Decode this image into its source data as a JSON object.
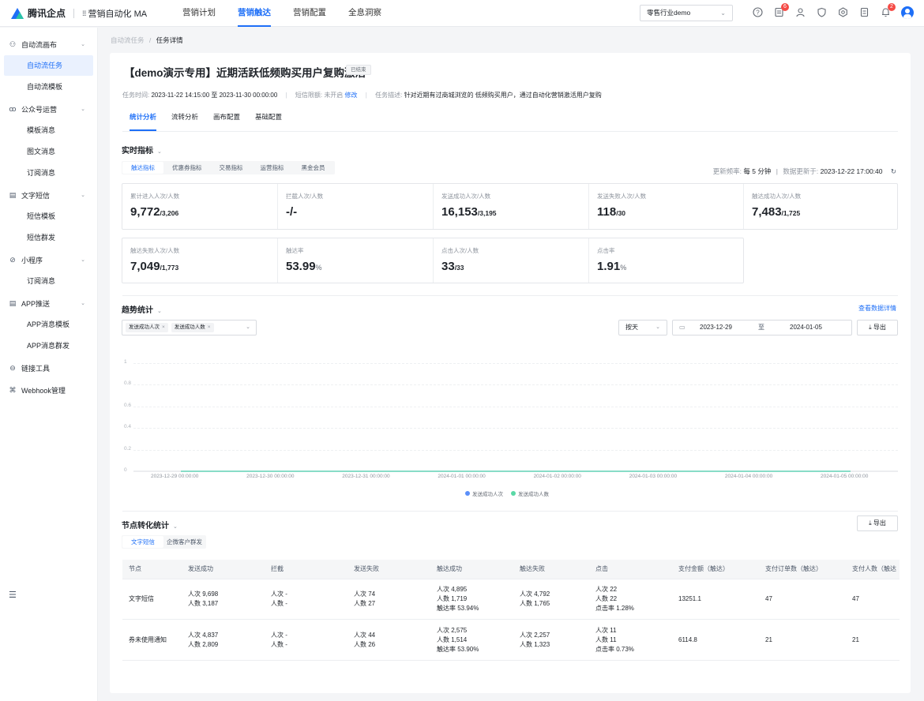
{
  "header": {
    "logo_text": "腾讯企点",
    "product": "营销自动化 MA",
    "nav": [
      "营销计划",
      "营销触达",
      "营销配置",
      "全息洞察"
    ],
    "active_nav": 1,
    "tenant": "零售行业demo",
    "badge1": "6",
    "badge2": "2"
  },
  "sidebar": {
    "groups": [
      {
        "label": "自动流画布",
        "icon": "flow-icon",
        "items": [
          "自动流任务",
          "自动流模板"
        ]
      },
      {
        "label": "公众号运营",
        "icon": "wechat-icon",
        "items": [
          "模板消息",
          "图文消息",
          "订阅消息"
        ]
      },
      {
        "label": "文字短信",
        "icon": "sms-icon",
        "items": [
          "短信模板",
          "短信群发"
        ]
      },
      {
        "label": "小程序",
        "icon": "miniprogram-icon",
        "items": [
          "订阅消息"
        ]
      },
      {
        "label": "APP推送",
        "icon": "push-icon",
        "items": [
          "APP消息模板",
          "APP消息群发"
        ]
      },
      {
        "label": "链接工具",
        "icon": "link-icon",
        "items": []
      },
      {
        "label": "Webhook管理",
        "icon": "webhook-icon",
        "items": []
      }
    ]
  },
  "breadcrumb": {
    "parent": "自动流任务",
    "sep": "/",
    "current": "任务详情"
  },
  "task": {
    "title": "【demo演示专用】近期活跃低频购买用户复购激活",
    "status": "已结束",
    "time_label": "任务时间:",
    "time_value": "2023-11-22 14:15:00 至 2023-11-30 00:00:00",
    "quota_label": "短信限额:",
    "quota_value": "未开启",
    "quota_link": "修改",
    "desc_label": "任务描述:",
    "desc_value": "针对近期有过商城浏览的 低频购买用户，通过自动化营销激活用户复购"
  },
  "tabs": [
    "统计分析",
    "流转分析",
    "画布配置",
    "基础配置"
  ],
  "realtime": {
    "title": "实时指标",
    "subtabs": [
      "触达指标",
      "优惠券指标",
      "交易指标",
      "运营指标",
      "黑金会员"
    ],
    "freq_label": "更新频率:",
    "freq_value": "每 5 分钟",
    "updated_label": "数据更新于:",
    "updated_value": "2023-12-22 17:00:40",
    "metrics_row1": [
      {
        "label": "累计进入人次/人数",
        "main": "9,772",
        "sub": "/3,206"
      },
      {
        "label": "拦截人次/人数",
        "main": "-/-",
        "sub": ""
      },
      {
        "label": "发送成功人次/人数",
        "main": "16,153",
        "sub": "/3,195"
      },
      {
        "label": "发送失败人次/人数",
        "main": "118",
        "sub": "/30"
      },
      {
        "label": "触达成功人次/人数",
        "main": "7,483",
        "sub": "/1,725"
      }
    ],
    "metrics_row2": [
      {
        "label": "触达失败人次/人数",
        "main": "7,049",
        "sub": "/1,773",
        "pct": ""
      },
      {
        "label": "触达率",
        "main": "53.99",
        "sub": "",
        "pct": "%"
      },
      {
        "label": "点击人次/人数",
        "main": "33",
        "sub": "/33",
        "pct": ""
      },
      {
        "label": "点击率",
        "main": "1.91",
        "sub": "",
        "pct": "%"
      }
    ]
  },
  "trend": {
    "title": "趋势统计",
    "detail_link": "查看数据详情",
    "tags": [
      "发送成功人次",
      "发送成功人数"
    ],
    "period": "按天",
    "date_from": "2023-12-29",
    "date_to_sep": "至",
    "date_to": "2024-01-05",
    "export": "导出",
    "legend": [
      {
        "name": "发送成功人次",
        "color": "#5b8ff9"
      },
      {
        "name": "发送成功人数",
        "color": "#5ad8a6"
      }
    ]
  },
  "chart_data": {
    "type": "line",
    "x": [
      "2023-12-29 00:00:00",
      "2023-12-30 00:00:00",
      "2023-12-31 00:00:00",
      "2024-01-01 00:00:00",
      "2024-01-02 00:00:00",
      "2024-01-03 00:00:00",
      "2024-01-04 00:00:00",
      "2024-01-05 00:00:00"
    ],
    "series": [
      {
        "name": "发送成功人次",
        "values": [
          0,
          0,
          0,
          0,
          0,
          0,
          0,
          0
        ]
      },
      {
        "name": "发送成功人数",
        "values": [
          0,
          0,
          0,
          0,
          0,
          0,
          0,
          0
        ]
      }
    ],
    "yticks": [
      "1",
      "0.8",
      "0.6",
      "0.4",
      "0.2",
      "0"
    ],
    "ylim": [
      0,
      1
    ],
    "legend": "bottom",
    "grid": true
  },
  "node": {
    "title": "节点转化统计",
    "export": "导出",
    "subtabs": [
      "文字短信",
      "企微客户群发"
    ],
    "columns": [
      "节点",
      "发送成功",
      "拦截",
      "发送失败",
      "触达成功",
      "触达失败",
      "点击",
      "支付金额（触达）",
      "支付订单数（触达）",
      "支付人数（触达"
    ],
    "rows": [
      {
        "node": "文字短信",
        "c1": [
          "人次 9,698",
          "人数 3,187"
        ],
        "c2": [
          "人次 -",
          "人数 -"
        ],
        "c3": [
          "人次 74",
          "人数 27"
        ],
        "c4": [
          "人次 4,895",
          "人数 1,719",
          "触达率 53.94%"
        ],
        "c5": [
          "人次 4,792",
          "人数 1,765"
        ],
        "c6": [
          "人次 22",
          "人数 22",
          "点击率 1.28%"
        ],
        "c7": "13251.1",
        "c8": "47",
        "c9": "47"
      },
      {
        "node": "券未使用通知",
        "c1": [
          "人次 4,837",
          "人数 2,809"
        ],
        "c2": [
          "人次 -",
          "人数 -"
        ],
        "c3": [
          "人次 44",
          "人数 26"
        ],
        "c4": [
          "人次 2,575",
          "人数 1,514",
          "触达率 53.90%"
        ],
        "c5": [
          "人次 2,257",
          "人数 1,323"
        ],
        "c6": [
          "人次 11",
          "人数 11",
          "点击率 0.73%"
        ],
        "c7": "6114.8",
        "c8": "21",
        "c9": "21"
      }
    ]
  }
}
